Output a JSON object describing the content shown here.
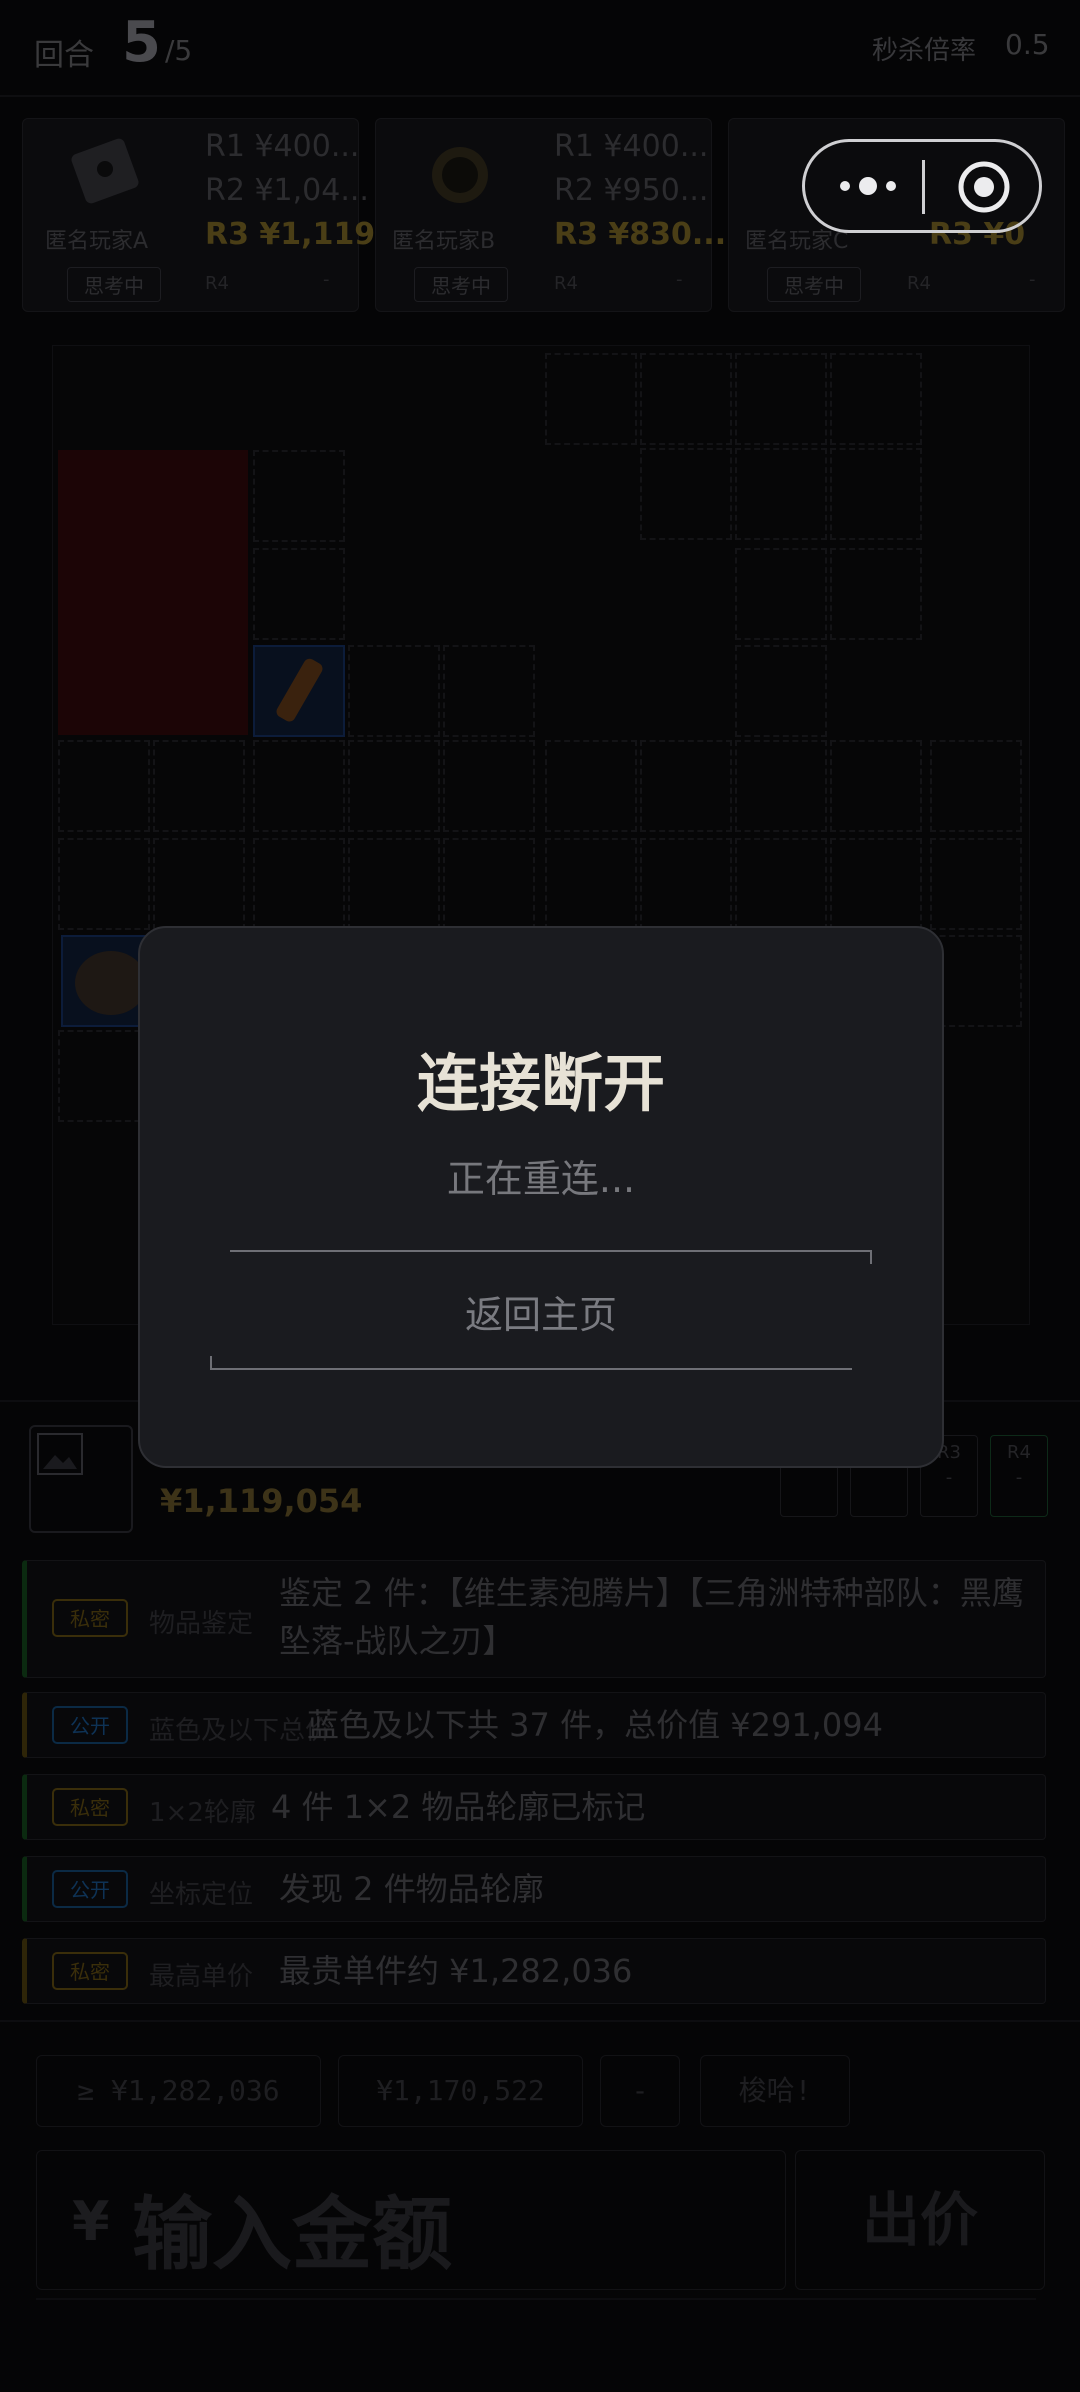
{
  "status": {
    "round_label": "回合",
    "round_current": "5",
    "round_total": "/5",
    "rate_label": "秒杀倍率",
    "rate_value": "0.5"
  },
  "players": [
    {
      "name": "匿名玩家A",
      "status": "思考中",
      "bids": [
        "R1 ¥400...",
        "R2 ¥1,04...",
        "R3 ¥1,119..."
      ],
      "r4_label": "R4",
      "r4_value": "-"
    },
    {
      "name": "匿名玩家B",
      "status": "思考中",
      "bids": [
        "R1 ¥400...",
        "R2 ¥950...",
        "R3 ¥830..."
      ],
      "r4_label": "R4",
      "r4_value": "-"
    },
    {
      "name": "匿名玩家C",
      "status": "思考中",
      "bids": [
        "R3 ¥0"
      ],
      "r4_label": "R4",
      "r4_value": "-"
    }
  ],
  "capsule": {
    "more_icon": "more-dots-icon",
    "close_icon": "target-circle-icon"
  },
  "current_item": {
    "price": "¥1,119,054",
    "round_boxes": [
      {
        "label": "",
        "value": "-"
      },
      {
        "label": "",
        "value": "-"
      },
      {
        "label": "R3",
        "value": "-"
      },
      {
        "label": "R4",
        "value": "-"
      }
    ]
  },
  "clues": [
    {
      "tag": "私密",
      "title": "物品鉴定",
      "body": "鉴定 2 件：【维生素泡腾片】【三角洲特种部队：黑鹰坠落-战队之刃】"
    },
    {
      "tag": "公开",
      "title": "蓝色及以下总价",
      "body": "蓝色及以下共 37 件，总价值 ¥291,094"
    },
    {
      "tag": "私密",
      "title": "1×2轮廓",
      "body": "4 件 1×2 物品轮廓已标记"
    },
    {
      "tag": "公开",
      "title": "坐标定位",
      "body": "发现 2 件物品轮廓"
    },
    {
      "tag": "私密",
      "title": "最高单价",
      "body": "最贵单件约 ¥1,282,036"
    }
  ],
  "bid": {
    "quick_min": "≥ ¥1,282,036",
    "quick_last": "¥1,170,522",
    "quick_dash": "-",
    "quick_kill": "梭哈!",
    "currency": "¥",
    "input_placeholder": "输入金额",
    "submit_label": "出价"
  },
  "modal": {
    "title": "连接断开",
    "subtitle": "正在重连...",
    "home_button": "返回主页"
  },
  "colors": {
    "accent_gold": "#d4a62a",
    "red_zone": "#c0161c",
    "modal_bg": "#1a1b1f",
    "title_text": "#e7e2d6"
  }
}
